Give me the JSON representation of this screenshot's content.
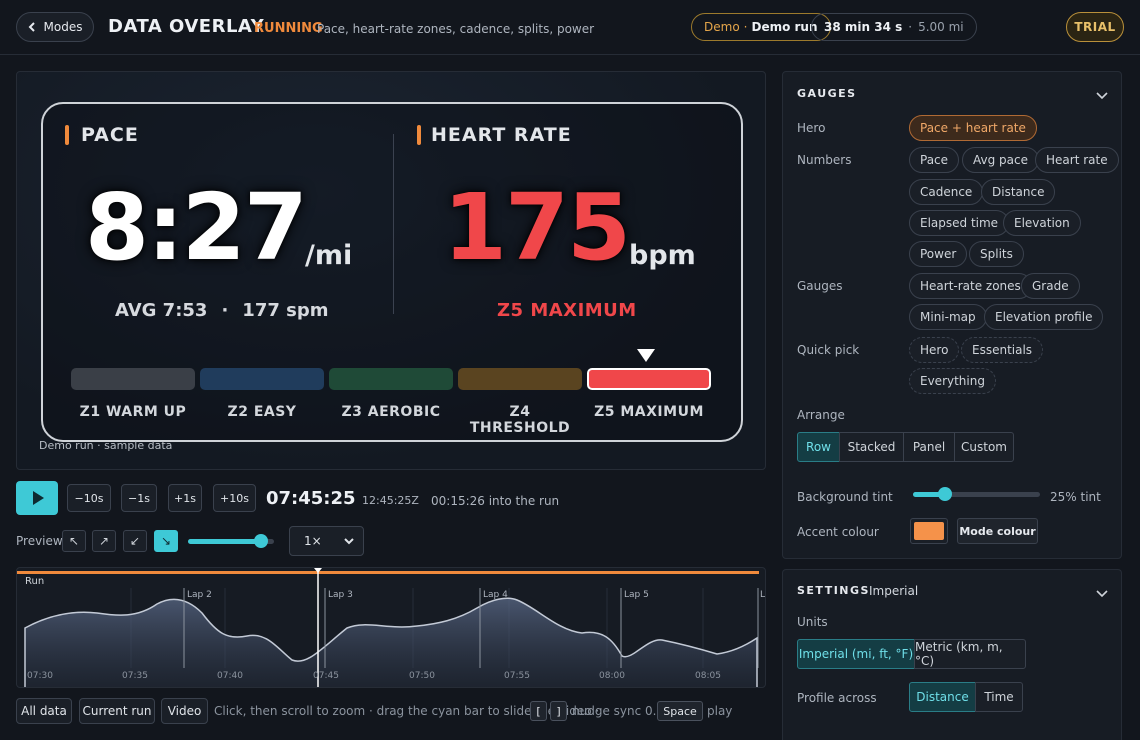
{
  "header": {
    "modes_label": "Modes",
    "title": "DATA OVERLAY",
    "mode_name": "RUNNING",
    "mode_desc": "Pace, heart-rate zones, cadence, splits, power",
    "demo_label": "Demo",
    "demo_value": "Demo run",
    "duration": "38 min 34 s",
    "distance": "5.00 mi",
    "badge": "TRIAL"
  },
  "overlay": {
    "pace_label": "PACE",
    "pace_value": "8:27",
    "pace_unit": "/mi",
    "avg_pace": "AVG 7:53",
    "separator": "·",
    "cadence": "177 spm",
    "hr_label": "HEART RATE",
    "hr_value": "175",
    "hr_unit": "bpm",
    "zone_current": "Z5  MAXIMUM",
    "zones": [
      {
        "label": "Z1 WARM UP",
        "color": "#3a3f47"
      },
      {
        "label": "Z2 EASY",
        "color": "#203c5c"
      },
      {
        "label": "Z3 AEROBIC",
        "color": "#1f4a37"
      },
      {
        "label": "Z4 THRESHOLD",
        "color": "#5a4420"
      },
      {
        "label": "Z5 MAXIMUM",
        "color": "#f0474a"
      }
    ],
    "active_zone_index": 4,
    "sample_note": "Demo run · sample data"
  },
  "controls": {
    "skip_buttons": [
      "−10s",
      "−1s",
      "+1s",
      "+10s"
    ],
    "clock": "07:45:25",
    "utc": "12:45:25Z",
    "into_run": "00:15:26 into the run",
    "preview_label": "Preview",
    "corners": [
      "↖",
      "↗",
      "↙",
      "↘"
    ],
    "active_corner": 3,
    "preview_size_fraction": 0.85,
    "speed": "1×"
  },
  "timeline": {
    "run_label": "Run",
    "laps": [
      "Lap 2",
      "Lap 3",
      "Lap 4",
      "Lap 5",
      "L"
    ],
    "ticks": [
      "07:30",
      "07:35",
      "07:40",
      "07:45",
      "07:50",
      "07:55",
      "08:00",
      "08:05"
    ]
  },
  "footer": {
    "buttons": [
      "All data",
      "Current run",
      "Video"
    ],
    "hint1": "Click, then scroll to zoom · drag the cyan bar to slide the video ·",
    "key_left": "[",
    "key_right": "]",
    "hint2": "nudge sync 0.1 s ·",
    "key_space": "Space",
    "hint3": "play"
  },
  "gauges_panel": {
    "title": "GAUGES",
    "rows": {
      "hero": "Hero",
      "numbers": "Numbers",
      "gauges": "Gauges",
      "quick_pick": "Quick pick",
      "arrange": "Arrange",
      "bg_tint": "Background tint",
      "accent": "Accent colour"
    },
    "hero_chip": "Pace + heart rate",
    "number_chips": [
      "Pace",
      "Avg pace",
      "Heart rate",
      "Cadence",
      "Distance",
      "Elapsed time",
      "Elevation",
      "Power",
      "Splits"
    ],
    "gauge_chips": [
      "Heart-rate zones",
      "Grade",
      "Mini-map",
      "Elevation profile"
    ],
    "quick_chips": [
      "Hero",
      "Essentials",
      "Everything"
    ],
    "arrange_options": [
      "Row",
      "Stacked",
      "Panel",
      "Custom"
    ],
    "arrange_active": 0,
    "tint_value": "25% tint",
    "tint_fraction": 0.25,
    "accent_color": "#f5924a",
    "mode_colour_label": "Mode colour"
  },
  "settings_panel": {
    "title": "SETTINGS",
    "subtitle": "Imperial",
    "units_label": "Units",
    "unit_options": [
      "Imperial (mi, ft, °F)",
      "Metric (km, m, °C)"
    ],
    "profile_label": "Profile across",
    "profile_options": [
      "Distance",
      "Time"
    ]
  }
}
